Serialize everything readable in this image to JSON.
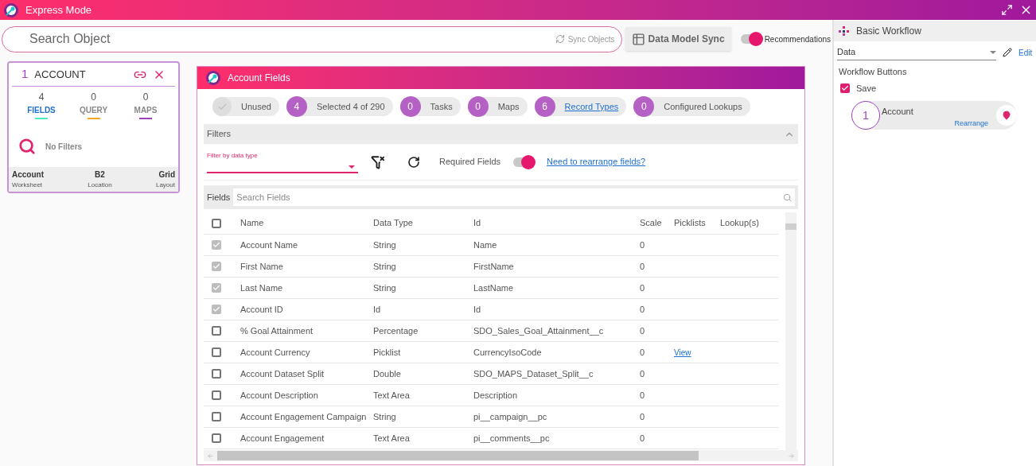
{
  "window": {
    "title": "Express Mode"
  },
  "toolbar": {
    "search": {
      "placeholder": "Search Object"
    },
    "sync_objects": "Sync Objects",
    "data_model_sync": "Data Model Sync",
    "recommendations": {
      "label": "Recommendations",
      "on": true
    }
  },
  "object_card": {
    "index": "1",
    "name": "ACCOUNT",
    "stats": [
      {
        "value": "4",
        "label": "FIELDS",
        "selected": true,
        "color": "#4de8c0"
      },
      {
        "value": "0",
        "label": "QUERY",
        "selected": false,
        "color": "#f5a623"
      },
      {
        "value": "0",
        "label": "MAPS",
        "selected": false,
        "color": "#a040c0"
      }
    ],
    "filters": "No Filters",
    "footer": [
      {
        "value": "Account",
        "label": "Worksheet"
      },
      {
        "value": "B2",
        "label": "Location"
      },
      {
        "value": "Grid",
        "label": "Layout"
      }
    ]
  },
  "fields_panel": {
    "title": "Account Fields",
    "chips": [
      {
        "kind": "check",
        "label": "Unused",
        "link": false
      },
      {
        "kind": "count",
        "count": "4",
        "label": "Selected 4 of 290",
        "link": false
      },
      {
        "kind": "count",
        "count": "0",
        "label": "Tasks",
        "link": false
      },
      {
        "kind": "count",
        "count": "0",
        "label": "Maps",
        "link": false
      },
      {
        "kind": "count",
        "count": "6",
        "label": "Record Types",
        "link": true
      },
      {
        "kind": "count",
        "count": "0",
        "label": "Configured Lookups",
        "link": false
      }
    ],
    "filters": {
      "title": "Filters",
      "expanded": true,
      "data_type_label": "Filter by data type",
      "required_fields": {
        "label": "Required Fields",
        "on": true
      },
      "rearrange_link": "Need to rearrange fields?"
    },
    "search": {
      "label": "Fields",
      "placeholder": "Search Fields"
    },
    "table": {
      "all_checked": false,
      "columns": [
        "Name",
        "Data Type",
        "Id",
        "Scale",
        "Picklists",
        "Lookup(s)"
      ],
      "rows": [
        {
          "checked": true,
          "name": "Account Name",
          "type": "String",
          "id": "Name",
          "scale": "0"
        },
        {
          "checked": true,
          "name": "First Name",
          "type": "String",
          "id": "FirstName",
          "scale": "0"
        },
        {
          "checked": true,
          "name": "Last Name",
          "type": "String",
          "id": "LastName",
          "scale": "0"
        },
        {
          "checked": true,
          "name": "Account ID",
          "type": "Id",
          "id": "Id",
          "scale": "0"
        },
        {
          "checked": false,
          "name": "% Goal Attainment",
          "type": "Percentage",
          "id": "SDO_Sales_Goal_Attainment__c",
          "scale": "0"
        },
        {
          "checked": false,
          "name": "Account Currency",
          "type": "Picklist",
          "id": "CurrencyIsoCode",
          "scale": "0",
          "picklists": "View"
        },
        {
          "checked": false,
          "name": "Account Dataset Split",
          "type": "Double",
          "id": "SDO_MAPS_Dataset_Split__c",
          "scale": "0"
        },
        {
          "checked": false,
          "name": "Account Description",
          "type": "Text Area",
          "id": "Description",
          "scale": "0"
        },
        {
          "checked": false,
          "name": "Account Engagement Campaign",
          "type": "String",
          "id": "pi__campaign__pc",
          "scale": "0"
        },
        {
          "checked": false,
          "name": "Account Engagement",
          "type": "Text Area",
          "id": "pi__comments__pc",
          "scale": "0"
        }
      ]
    }
  },
  "workflow": {
    "title": "Basic Workflow",
    "select": "Data",
    "edit": "Edit",
    "buttons_title": "Workflow Buttons",
    "save": {
      "label": "Save",
      "checked": true
    },
    "steps": [
      {
        "number": "1",
        "name": "Account",
        "action": "Rearrange"
      }
    ]
  }
}
